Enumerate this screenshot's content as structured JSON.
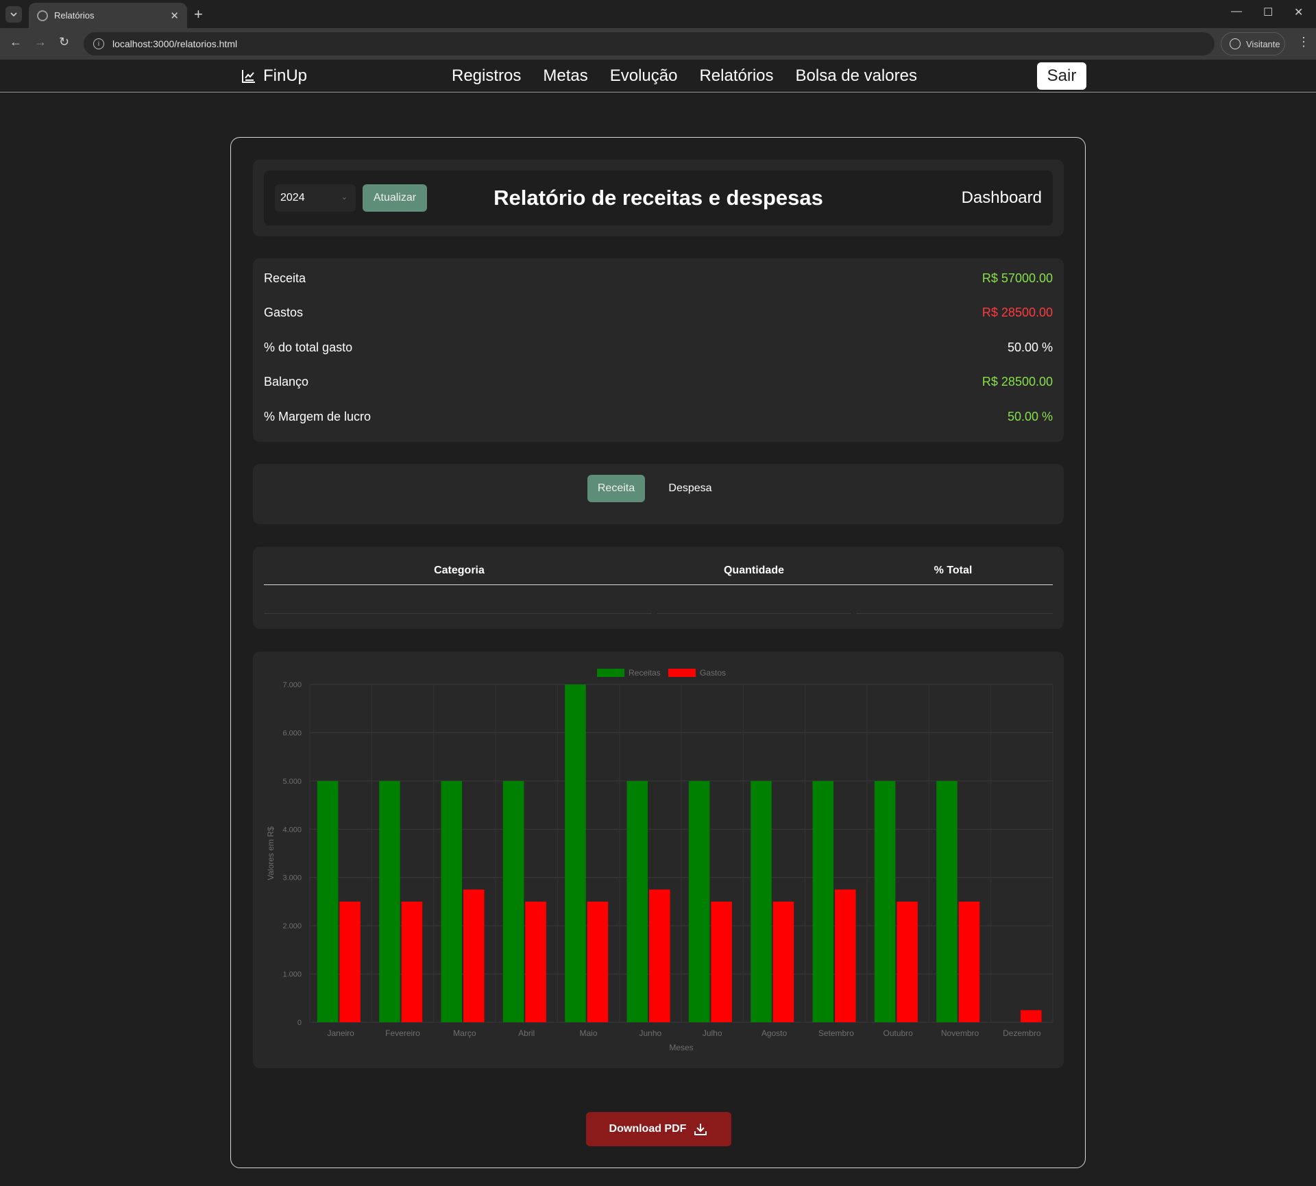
{
  "browser": {
    "tab_title": "Relatórios",
    "url": "localhost:3000/relatorios.html",
    "profile": "Visitante"
  },
  "header": {
    "brand": "FinUp",
    "nav": [
      "Registros",
      "Metas",
      "Evolução",
      "Relatórios",
      "Bolsa de valores"
    ],
    "logout": "Sair"
  },
  "toolbar": {
    "year": "2024",
    "update_button": "Atualizar",
    "title": "Relatório de receitas e despesas",
    "dashboard_link": "Dashboard"
  },
  "summary": {
    "rows": [
      {
        "label": "Receita",
        "value": "R$ 57000.00",
        "color": "#86e04c"
      },
      {
        "label": "Gastos",
        "value": "R$ 28500.00",
        "color": "#ff3b3b"
      },
      {
        "label": "% do total gasto",
        "value": "50.00 %",
        "color": "#ffffff"
      },
      {
        "label": "Balanço",
        "value": "R$ 28500.00",
        "color": "#86e04c"
      },
      {
        "label": "% Margem de lucro",
        "value": "50.00 %",
        "color": "#86e04c"
      }
    ]
  },
  "tabs": {
    "receita": "Receita",
    "despesa": "Despesa",
    "active_color": "#5f8e78"
  },
  "table": {
    "headers": [
      "Categoria",
      "Quantidade",
      "% Total"
    ]
  },
  "chart_data": {
    "type": "bar",
    "categories": [
      "Janeiro",
      "Fevereiro",
      "Março",
      "Abril",
      "Maio",
      "Junho",
      "Julho",
      "Agosto",
      "Setembro",
      "Outubro",
      "Novembro",
      "Dezembro"
    ],
    "series": [
      {
        "name": "Receitas",
        "color": "#008000",
        "values": [
          5000,
          5000,
          5000,
          5000,
          7000,
          5000,
          5000,
          5000,
          5000,
          5000,
          5000,
          0
        ]
      },
      {
        "name": "Gastos",
        "color": "#ff0000",
        "values": [
          2500,
          2500,
          2750,
          2500,
          2500,
          2750,
          2500,
          2500,
          2750,
          2500,
          2500,
          250
        ]
      }
    ],
    "ylim": [
      0,
      7000
    ],
    "yticks": [
      "0",
      "1.000",
      "2.000",
      "3.000",
      "4.000",
      "5.000",
      "6.000",
      "7.000"
    ],
    "ylabel": "Valores em R$",
    "xlabel": "Meses",
    "legend_position": "top",
    "grid": true
  },
  "download_button": "Download PDF"
}
